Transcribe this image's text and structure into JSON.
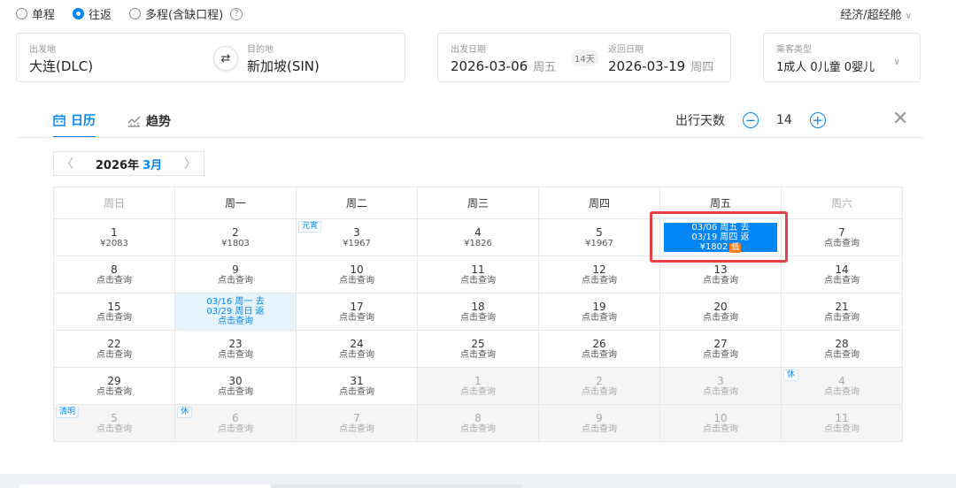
{
  "trip_types": [
    {
      "label": "单程",
      "selected": false
    },
    {
      "label": "往返",
      "selected": true
    },
    {
      "label": "多程(含缺口程)",
      "selected": false
    }
  ],
  "cabin": {
    "label": "经济/超经舱"
  },
  "from": {
    "label": "出发地",
    "value": "大连(DLC)"
  },
  "to": {
    "label": "目的地",
    "value": "新加坡(SIN)"
  },
  "depart": {
    "label": "出发日期",
    "date": "2026-03-06",
    "weekday": "周五"
  },
  "ret": {
    "label": "返回日期",
    "date": "2026-03-19",
    "weekday": "周四"
  },
  "trip_days": "14天",
  "passengers": {
    "label": "乘客类型",
    "value": "1成人  0儿童  0婴儿"
  },
  "tabs": [
    {
      "label": "日历",
      "active": true
    },
    {
      "label": "趋势",
      "active": false
    }
  ],
  "duration": {
    "label": "出行天数",
    "value": "14",
    "minus": "−",
    "plus": "+"
  },
  "month_nav": {
    "year": "2026年",
    "month": "3月"
  },
  "weekdays": [
    "周日",
    "周一",
    "周二",
    "周三",
    "周四",
    "周五",
    "周六"
  ],
  "calendar": [
    [
      {
        "day": "1",
        "price": "¥2083"
      },
      {
        "day": "2",
        "price": "¥1803"
      },
      {
        "day": "3",
        "price": "¥1967",
        "tag": "元宵"
      },
      {
        "day": "4",
        "price": "¥1826"
      },
      {
        "day": "5",
        "price": "¥1967"
      },
      {
        "selected": true,
        "line1": "03/06 周五 去",
        "line2": "03/19 周四 返",
        "price": "¥1802",
        "low": "低"
      },
      {
        "day": "7",
        "price": "点击查询"
      }
    ],
    [
      {
        "day": "8",
        "price": "点击查询"
      },
      {
        "day": "9",
        "price": "点击查询"
      },
      {
        "day": "10",
        "price": "点击查询"
      },
      {
        "day": "11",
        "price": "点击查询"
      },
      {
        "day": "12",
        "price": "点击查询"
      },
      {
        "day": "13",
        "price": "点击查询"
      },
      {
        "day": "14",
        "price": "点击查询"
      }
    ],
    [
      {
        "day": "15",
        "price": "点击查询"
      },
      {
        "hover": true,
        "line1": "03/16 周一 去",
        "line2": "03/29 周日 返",
        "price": "点击查询"
      },
      {
        "day": "17",
        "price": "点击查询"
      },
      {
        "day": "18",
        "price": "点击查询"
      },
      {
        "day": "19",
        "price": "点击查询"
      },
      {
        "day": "20",
        "price": "点击查询"
      },
      {
        "day": "21",
        "price": "点击查询"
      }
    ],
    [
      {
        "day": "22",
        "price": "点击查询"
      },
      {
        "day": "23",
        "price": "点击查询"
      },
      {
        "day": "24",
        "price": "点击查询"
      },
      {
        "day": "25",
        "price": "点击查询"
      },
      {
        "day": "26",
        "price": "点击查询"
      },
      {
        "day": "27",
        "price": "点击查询"
      },
      {
        "day": "28",
        "price": "点击查询"
      }
    ],
    [
      {
        "day": "29",
        "price": "点击查询"
      },
      {
        "day": "30",
        "price": "点击查询"
      },
      {
        "day": "31",
        "price": "点击查询"
      },
      {
        "day": "1",
        "price": "点击查询",
        "other": true
      },
      {
        "day": "2",
        "price": "点击查询",
        "other": true
      },
      {
        "day": "3",
        "price": "点击查询",
        "other": true
      },
      {
        "day": "4",
        "price": "点击查询",
        "other": true,
        "tag": "休"
      }
    ],
    [
      {
        "day": "5",
        "price": "点击查询",
        "other": true,
        "tag": "清明"
      },
      {
        "day": "6",
        "price": "点击查询",
        "other": true,
        "tag": "休"
      },
      {
        "day": "7",
        "price": "点击查询",
        "other": true
      },
      {
        "day": "8",
        "price": "点击查询",
        "other": true
      },
      {
        "day": "9",
        "price": "点击查询",
        "other": true
      },
      {
        "day": "10",
        "price": "点击查询",
        "other": true
      },
      {
        "day": "11",
        "price": "点击查询",
        "other": true
      }
    ]
  ],
  "colors": {
    "accent": "#0086f6",
    "highlight": "#e84040",
    "low_tag": "#ff7d13"
  }
}
